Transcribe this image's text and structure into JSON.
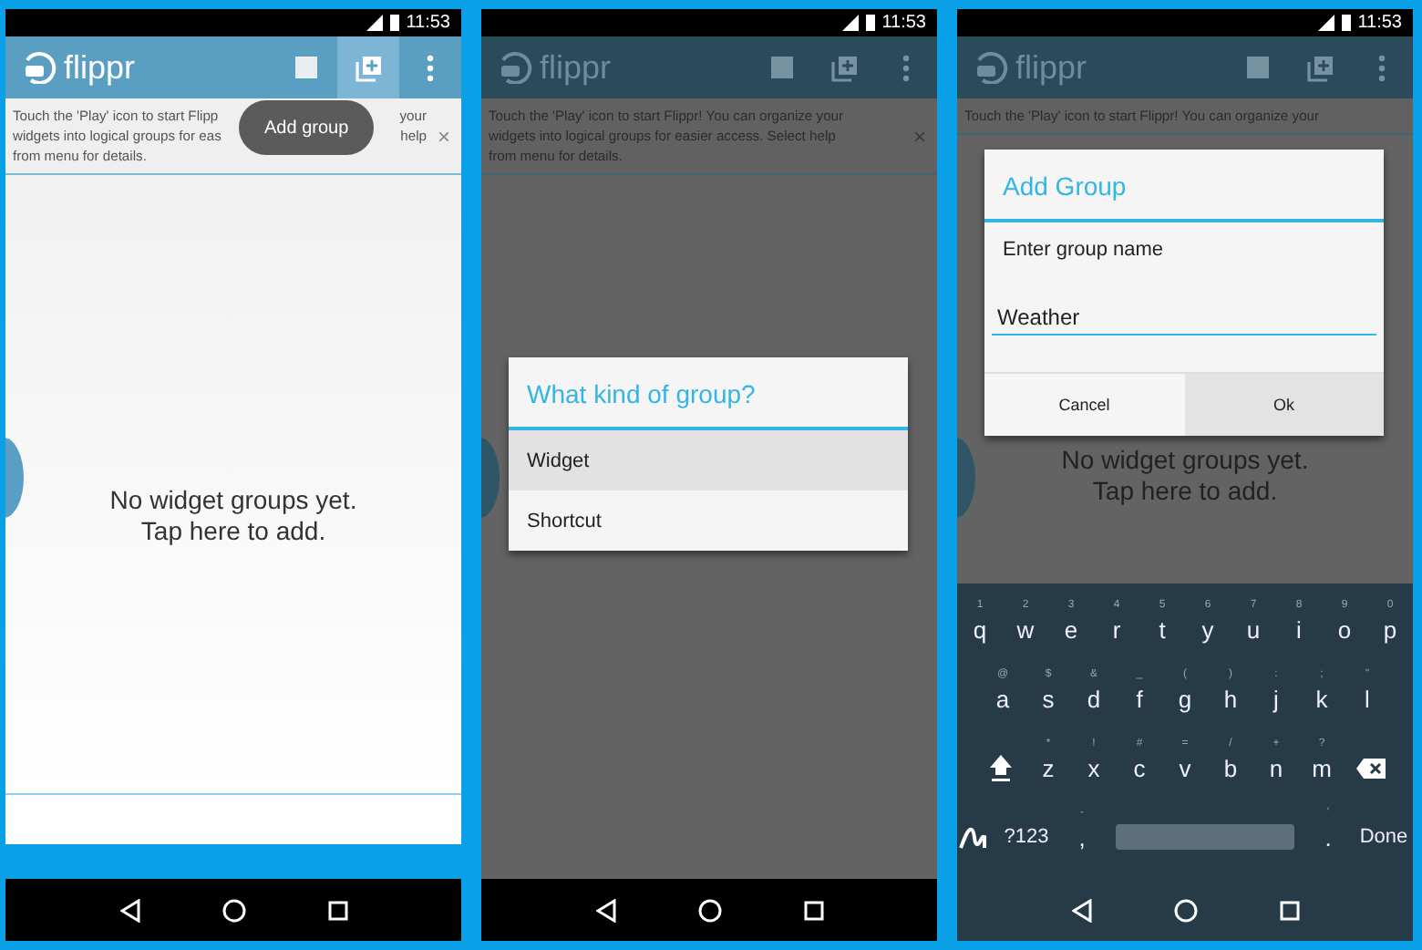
{
  "screens": [
    {
      "dimmed": false,
      "status_bar": {
        "time": "11:53"
      },
      "toolbar": {
        "title": "flippr",
        "actions": [
          {
            "kind": "square",
            "pressed": false
          },
          {
            "kind": "add",
            "pressed": true
          },
          {
            "kind": "more",
            "pressed": false
          }
        ]
      },
      "hint": {
        "lines": [
          [
            "Touch the 'Play' icon to start Flipp",
            "your"
          ],
          [
            "widgets into logical groups for eas",
            "help"
          ],
          [
            "from menu for details."
          ]
        ],
        "close": "×"
      },
      "tooltip": "Add group",
      "empty_message": [
        "No widget groups yet.",
        "Tap here to add."
      ]
    },
    {
      "dimmed": true,
      "status_bar": {
        "time": "11:53"
      },
      "toolbar": {
        "title": "flippr",
        "actions": [
          {
            "kind": "square",
            "pressed": false
          },
          {
            "kind": "add",
            "pressed": false
          },
          {
            "kind": "more",
            "pressed": false
          }
        ]
      },
      "hint": {
        "lines": [
          [
            "Touch the 'Play' icon to start Flippr! You can organize your"
          ],
          [
            "widgets into logical groups for easier access. Select help"
          ],
          [
            "from menu for details."
          ]
        ],
        "close": "×"
      },
      "dialog": {
        "kind": "choice",
        "title": "What kind of group?",
        "items": [
          {
            "label": "Widget",
            "selected": true
          },
          {
            "label": "Shortcut",
            "selected": false
          }
        ]
      }
    },
    {
      "dimmed": true,
      "status_bar": {
        "time": "11:53"
      },
      "toolbar": {
        "title": "flippr",
        "actions": [
          {
            "kind": "square",
            "pressed": false
          },
          {
            "kind": "add",
            "pressed": false
          },
          {
            "kind": "more",
            "pressed": false
          }
        ]
      },
      "hint": {
        "lines": [
          [
            "Touch the 'Play' icon to start Flippr! You can organize your"
          ]
        ]
      },
      "empty_message": [
        "No widget groups yet.",
        "Tap here to add."
      ],
      "dialog": {
        "kind": "input",
        "title": "Add Group",
        "prompt": "Enter group name",
        "value": "Weather",
        "buttons": [
          {
            "label": "Cancel",
            "pressed": false
          },
          {
            "label": "Ok",
            "pressed": true
          }
        ]
      },
      "keyboard": {
        "rows": [
          {
            "keys": [
              {
                "kind": "char",
                "label": "q",
                "hint": "1"
              },
              {
                "kind": "char",
                "label": "w",
                "hint": "2"
              },
              {
                "kind": "char",
                "label": "e",
                "hint": "3"
              },
              {
                "kind": "char",
                "label": "r",
                "hint": "4"
              },
              {
                "kind": "char",
                "label": "t",
                "hint": "5"
              },
              {
                "kind": "char",
                "label": "y",
                "hint": "6"
              },
              {
                "kind": "char",
                "label": "u",
                "hint": "7"
              },
              {
                "kind": "char",
                "label": "i",
                "hint": "8"
              },
              {
                "kind": "char",
                "label": "o",
                "hint": "9"
              },
              {
                "kind": "char",
                "label": "p",
                "hint": "0"
              }
            ]
          },
          {
            "keys": [
              {
                "kind": "char",
                "label": "a",
                "hint": "@"
              },
              {
                "kind": "char",
                "label": "s",
                "hint": "$"
              },
              {
                "kind": "char",
                "label": "d",
                "hint": "&"
              },
              {
                "kind": "char",
                "label": "f",
                "hint": "_"
              },
              {
                "kind": "char",
                "label": "g",
                "hint": "("
              },
              {
                "kind": "char",
                "label": "h",
                "hint": ")"
              },
              {
                "kind": "char",
                "label": "j",
                "hint": ":"
              },
              {
                "kind": "char",
                "label": "k",
                "hint": ";"
              },
              {
                "kind": "char",
                "label": "l",
                "hint": "\""
              }
            ]
          },
          {
            "keys": [
              {
                "kind": "shift"
              },
              {
                "kind": "char",
                "label": "z",
                "hint": "*"
              },
              {
                "kind": "char",
                "label": "x",
                "hint": "!"
              },
              {
                "kind": "char",
                "label": "c",
                "hint": "#"
              },
              {
                "kind": "char",
                "label": "v",
                "hint": "="
              },
              {
                "kind": "char",
                "label": "b",
                "hint": "/"
              },
              {
                "kind": "char",
                "label": "n",
                "hint": "+"
              },
              {
                "kind": "char",
                "label": "m",
                "hint": "?"
              },
              {
                "kind": "backspace"
              }
            ]
          },
          {
            "keys": [
              {
                "kind": "swipe"
              },
              {
                "kind": "action",
                "label": "?123"
              },
              {
                "kind": "char",
                "label": ",",
                "hint": "-"
              },
              {
                "kind": "space"
              },
              {
                "kind": "char",
                "label": ".",
                "hint": "'"
              },
              {
                "kind": "action",
                "label": "Done"
              }
            ]
          }
        ]
      }
    }
  ]
}
